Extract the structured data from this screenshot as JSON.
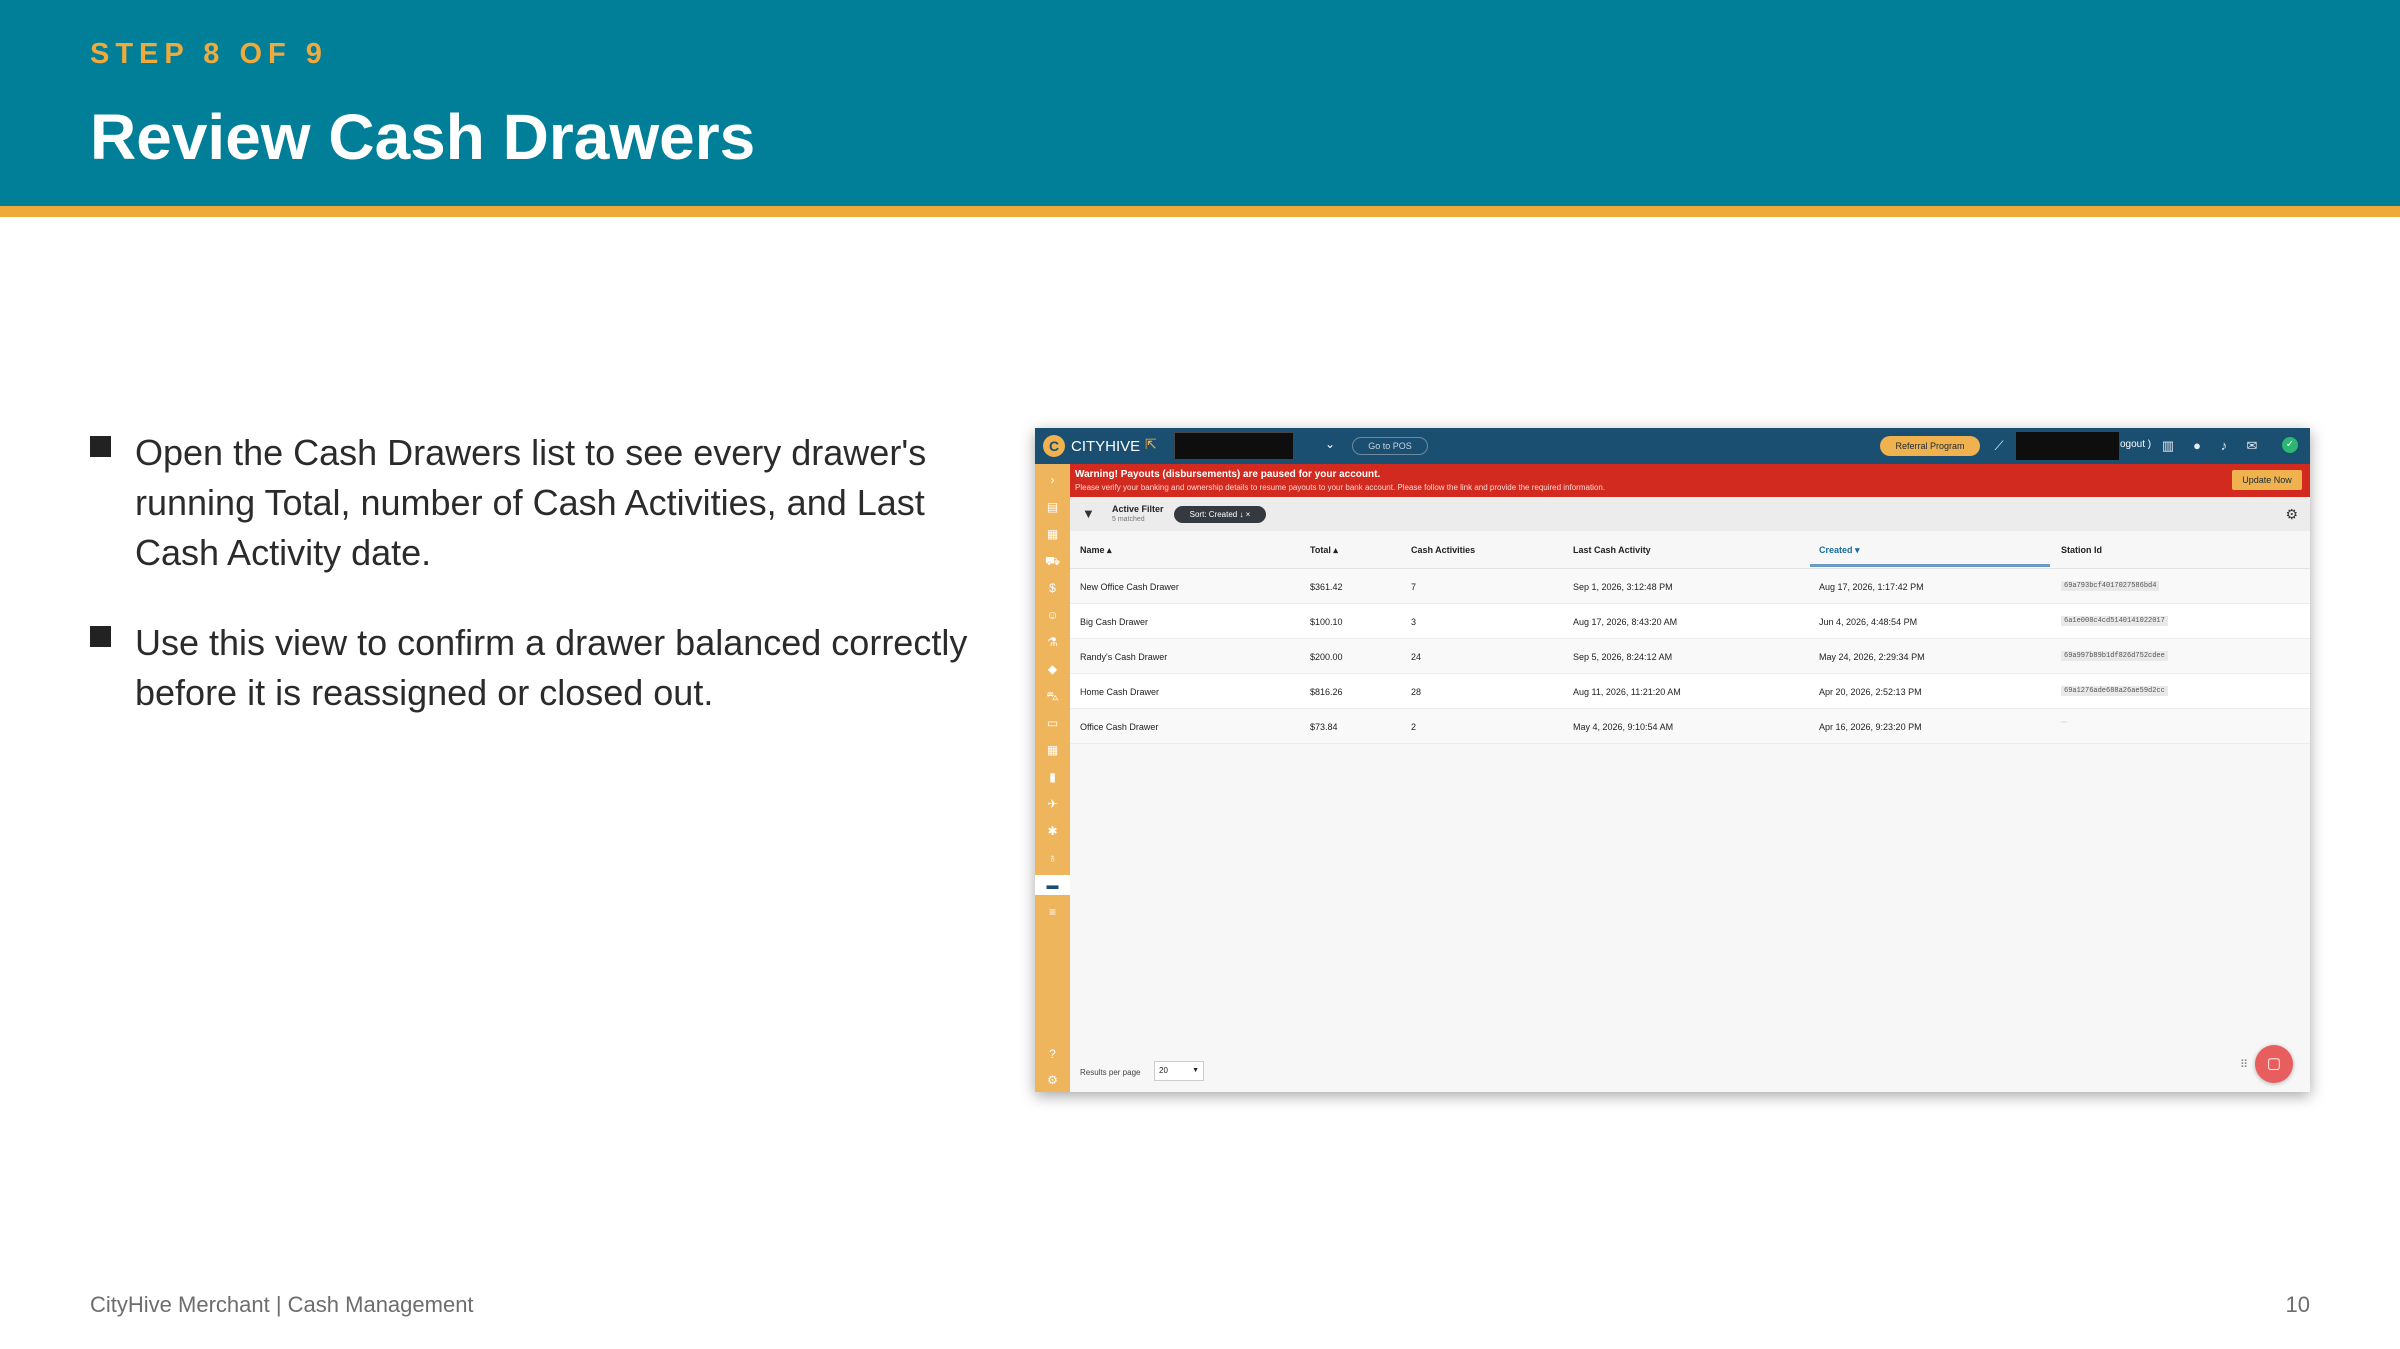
{
  "slide": {
    "step": "STEP 8 OF 9",
    "title": "Review Cash Drawers",
    "bullets": [
      "Open the Cash Drawers list to see every drawer's running Total, number of Cash Activities, and Last Cash Activity date.",
      "Use this view to confirm a drawer balanced correctly before it is reassigned or closed out."
    ],
    "footer": "CityHive Merchant  |  Cash Management",
    "page_number": "10"
  },
  "app": {
    "brand": "CITYHIVE",
    "go_to_pos": "Go to POS",
    "referral": "Referral Program",
    "logout": "ogout )",
    "warning_title": "Warning! Payouts (disbursements) are paused for your account.",
    "warning_sub": "Please verify your banking and ownership details to resume payouts to your bank account. Please follow the link and provide the required information.",
    "update_now": "Update Now",
    "filter_label": "Active Filter",
    "filter_count": "5 matched",
    "filter_chip": "Sort: Created ↓  ×",
    "columns": {
      "name": "Name ▴",
      "total": "Total ▴",
      "cash_activities": "Cash Activities",
      "last_cash_activity": "Last Cash Activity",
      "created": "Created ▾",
      "station_id": "Station Id"
    },
    "rows": [
      {
        "name": "New Office Cash Drawer",
        "total": "$361.42",
        "activities": "7",
        "last": "Sep 1, 2026, 3:12:48 PM",
        "created": "Aug 17, 2026, 1:17:42 PM",
        "station": "69a793bcf4017027586bd4"
      },
      {
        "name": "Big Cash Drawer",
        "total": "$100.10",
        "activities": "3",
        "last": "Aug 17, 2026, 8:43:20 AM",
        "created": "Jun 4, 2026, 4:48:54 PM",
        "station": "6a1e008c4cd5140141022017"
      },
      {
        "name": "Randy's Cash Drawer",
        "total": "$200.00",
        "activities": "24",
        "last": "Sep 5, 2026, 8:24:12 AM",
        "created": "May 24, 2026, 2:29:34 PM",
        "station": "69a997b89b1df826d752cdee"
      },
      {
        "name": "Home Cash Drawer",
        "total": "$816.26",
        "activities": "28",
        "last": "Aug 11, 2026, 11:21:20 AM",
        "created": "Apr 20, 2026, 2:52:13 PM",
        "station": "69a1276ade688a26ae59d2cc"
      },
      {
        "name": "Office Cash Drawer",
        "total": "$73.84",
        "activities": "2",
        "last": "May 4, 2026, 9:10:54 AM",
        "created": "Apr 16, 2026, 9:23:20 PM",
        "station": ""
      }
    ],
    "results_per_page_label": "Results per page",
    "results_per_page_value": "20"
  }
}
